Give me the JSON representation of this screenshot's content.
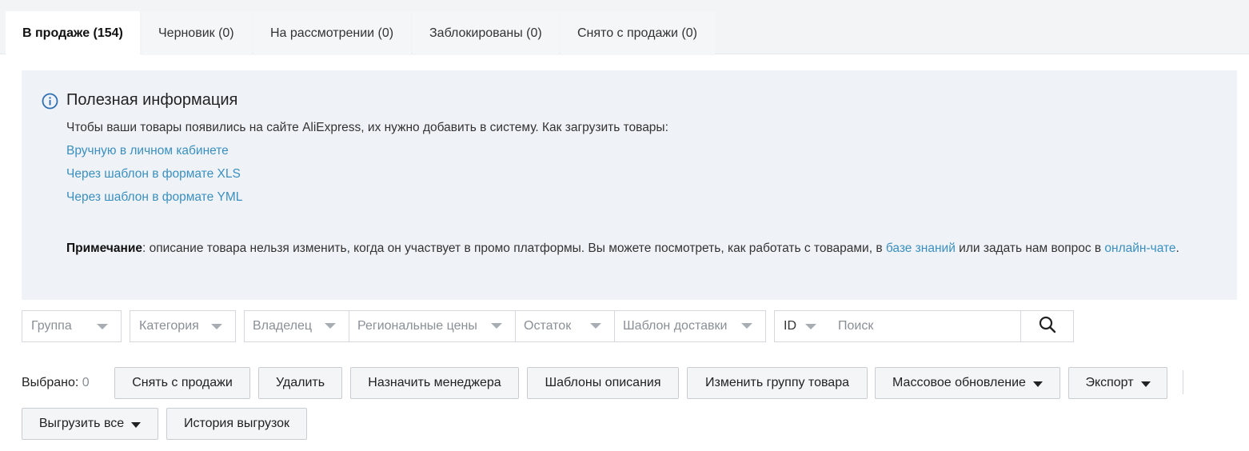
{
  "tabs": [
    {
      "label": "В продаже (154)",
      "active": true
    },
    {
      "label": "Черновик (0)"
    },
    {
      "label": "На рассмотрении (0)"
    },
    {
      "label": "Заблокированы (0)"
    },
    {
      "label": "Снято с продажи (0)"
    }
  ],
  "info": {
    "title": "Полезная информация",
    "text": "Чтобы ваши товары появились на сайте AliExpress, их нужно добавить в систему. Как загрузить товары:",
    "links": [
      "Вручную в личном кабинете",
      "Через шаблон в формате XLS",
      "Через шаблон в формате YML"
    ],
    "note_label": "Примечание",
    "note_text1": ": описание товара нельзя изменить, когда он участвует в промо платформы. Вы можете посмотреть, как работать с товарами, в ",
    "note_link1": "базе знаний",
    "note_text2": " или задать нам вопрос в ",
    "note_link2": "онлайн-чате",
    "note_end": "."
  },
  "filters": {
    "group": "Группа",
    "category": "Категория",
    "owner": "Владелец",
    "regional_prices": "Региональные цены",
    "stock": "Остаток",
    "delivery_template": "Шаблон доставки",
    "id": "ID",
    "search_placeholder": "Поиск"
  },
  "actions": {
    "selected_label": "Выбрано:",
    "selected_count": "0",
    "remove_from_sale": "Снять с продажи",
    "delete": "Удалить",
    "assign_manager": "Назначить менеджера",
    "description_templates": "Шаблоны описания",
    "change_group": "Изменить группу товара",
    "bulk_update": "Массовое обновление",
    "export": "Экспорт",
    "upload_all": "Выгрузить все",
    "upload_history": "История выгрузок"
  },
  "colors": {
    "link": "#3a8fbf",
    "info_bg": "#eff3f8",
    "info_icon": "#2f6fb3"
  }
}
